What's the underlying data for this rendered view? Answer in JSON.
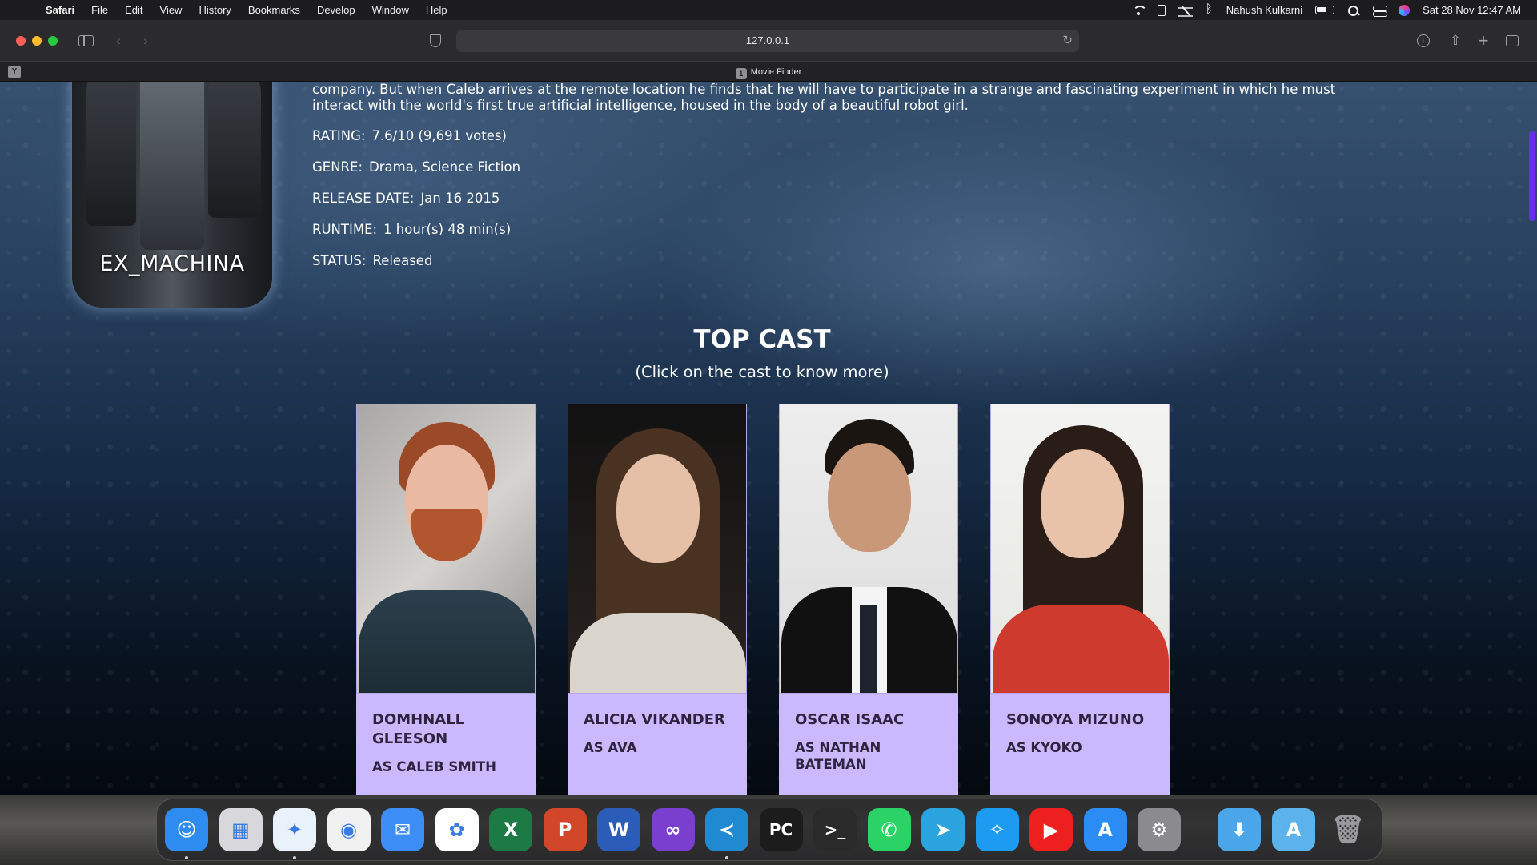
{
  "menubar": {
    "apple": "",
    "app_name": "Safari",
    "menus": [
      "File",
      "Edit",
      "View",
      "History",
      "Bookmarks",
      "Develop",
      "Window",
      "Help"
    ],
    "user": "Nahush Kulkarni",
    "datetime": "Sat 28 Nov  12:47 AM"
  },
  "browser": {
    "url": "127.0.0.1",
    "pinned_tab_letter": "Y",
    "tab_badge": "1",
    "tab_title": "Movie Finder",
    "back_glyph": "‹",
    "forward_glyph": "›",
    "reload_glyph": "↻",
    "download_glyph": "↓",
    "share_glyph": "⇧",
    "newtab_glyph": "+"
  },
  "movie": {
    "poster_title": "EX_MACHINA",
    "overview": "company. But when Caleb arrives at the remote location he finds that he will have to participate in a strange and fascinating experiment in which he must interact with the world's first true artificial intelligence, housed in the body of a beautiful robot girl.",
    "details": [
      {
        "label": "RATING:",
        "value": "7.6/10 (9,691 votes)"
      },
      {
        "label": "GENRE:",
        "value": "Drama, Science Fiction"
      },
      {
        "label": "RELEASE DATE:",
        "value": "Jan 16 2015"
      },
      {
        "label": "RUNTIME:",
        "value": "1 hour(s) 48 min(s)"
      },
      {
        "label": "STATUS:",
        "value": "Released"
      }
    ]
  },
  "cast_section": {
    "title": "TOP CAST",
    "subtitle": "(Click on the cast to know more)",
    "members": [
      {
        "name": "DOMHNALL GLEESON",
        "role": "AS CALEB SMITH"
      },
      {
        "name": "ALICIA VIKANDER",
        "role": "AS AVA"
      },
      {
        "name": "OSCAR ISAAC",
        "role": "AS NATHAN BATEMAN"
      },
      {
        "name": "SONOYA MIZUNO",
        "role": "AS KYOKO"
      }
    ]
  },
  "colors": {
    "card_background": "#cbb9ff",
    "card_text": "#2d2540",
    "scrollbar": "#6b2cf0"
  },
  "dock": {
    "apps": [
      {
        "name": "Finder",
        "icon": "finder-icon",
        "glyph": "☺",
        "color": "#2e8cf0",
        "running": true
      },
      {
        "name": "Launchpad",
        "icon": "launchpad-icon",
        "glyph": "▦",
        "color": "#d8d8dc",
        "running": false
      },
      {
        "name": "Safari",
        "icon": "safari-icon",
        "glyph": "✦",
        "color": "#e9f1fb",
        "running": true
      },
      {
        "name": "Chrome",
        "icon": "chrome-icon",
        "glyph": "◉",
        "color": "#f1f1f1",
        "running": false
      },
      {
        "name": "Mail",
        "icon": "mail-icon",
        "glyph": "✉",
        "color": "#3c8df5",
        "running": false
      },
      {
        "name": "Photos",
        "icon": "photos-icon",
        "glyph": "✿",
        "color": "#ffffff",
        "running": false
      },
      {
        "name": "Excel",
        "icon": "excel-icon",
        "glyph": "X",
        "color": "#1d7a45",
        "running": false
      },
      {
        "name": "PowerPoint",
        "icon": "powerpoint-icon",
        "glyph": "P",
        "color": "#d2472a",
        "running": false
      },
      {
        "name": "Word",
        "icon": "word-icon",
        "glyph": "W",
        "color": "#2b5cb8",
        "running": false
      },
      {
        "name": "Visual Studio",
        "icon": "visual-studio-icon",
        "glyph": "∞",
        "color": "#7a3fcf",
        "running": false
      },
      {
        "name": "VS Code",
        "icon": "vscode-icon",
        "glyph": "≺",
        "color": "#1f8ad2",
        "running": true
      },
      {
        "name": "PyCharm",
        "icon": "pycharm-icon",
        "glyph": "PC",
        "color": "#1c1c1c",
        "running": false
      },
      {
        "name": "Terminal",
        "icon": "terminal-icon",
        "glyph": ">_",
        "color": "#2a2a2a",
        "running": false
      },
      {
        "name": "WhatsApp",
        "icon": "whatsapp-icon",
        "glyph": "✆",
        "color": "#2bd366",
        "running": false
      },
      {
        "name": "Telegram",
        "icon": "telegram-icon",
        "glyph": "➤",
        "color": "#2aa3df",
        "running": false
      },
      {
        "name": "Twitter",
        "icon": "twitter-icon",
        "glyph": "✧",
        "color": "#1d9bf0",
        "running": false
      },
      {
        "name": "YouTube",
        "icon": "youtube-icon",
        "glyph": "▶",
        "color": "#ee1f1f",
        "running": false
      },
      {
        "name": "App Store",
        "icon": "app-store-icon",
        "glyph": "A",
        "color": "#2b8cf5",
        "running": false
      },
      {
        "name": "System Preferences",
        "icon": "system-preferences-icon",
        "glyph": "⚙",
        "color": "#8a8a8f",
        "running": false
      }
    ],
    "right_items": [
      {
        "name": "Downloads",
        "icon": "downloads-folder-icon",
        "glyph": "⬇",
        "color": "#4aa6e8"
      },
      {
        "name": "Applications",
        "icon": "applications-folder-icon",
        "glyph": "A",
        "color": "#5cb3ec"
      },
      {
        "name": "Trash",
        "icon": "trash-icon",
        "glyph": "🗑",
        "color": "#9a9a9e"
      }
    ]
  }
}
